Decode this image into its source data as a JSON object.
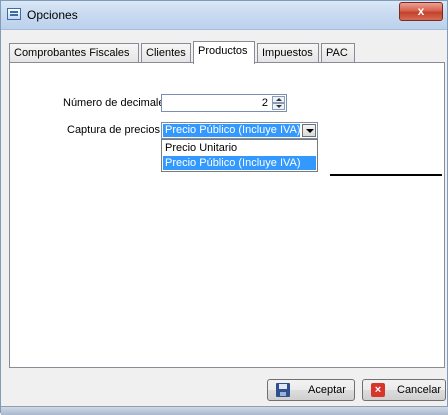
{
  "window": {
    "title": "Opciones",
    "close_glyph": "x"
  },
  "tabs": [
    {
      "label": "Comprobantes Fiscales",
      "active": false
    },
    {
      "label": "Clientes",
      "active": false
    },
    {
      "label": "Productos",
      "active": true
    },
    {
      "label": "Impuestos",
      "active": false
    },
    {
      "label": "PAC",
      "active": false
    }
  ],
  "form": {
    "decimals_label": "Número de decimales :",
    "decimals_value": "2",
    "price_capture_label": "Captura de precios :",
    "price_capture_value": "Precio Público (Incluye IVA)",
    "price_capture_options": [
      {
        "label": "Precio Unitario",
        "selected": false
      },
      {
        "label": "Precio Público (Incluye IVA)",
        "selected": true
      }
    ]
  },
  "buttons": {
    "accept_label": "Aceptar",
    "cancel_label": "Cancelar"
  },
  "icons": {
    "window": "window-app-icon",
    "accept": "save-disk-icon",
    "cancel": "cancel-x-icon"
  },
  "colors": {
    "selection": "#3399ff",
    "close": "#c2422d"
  }
}
